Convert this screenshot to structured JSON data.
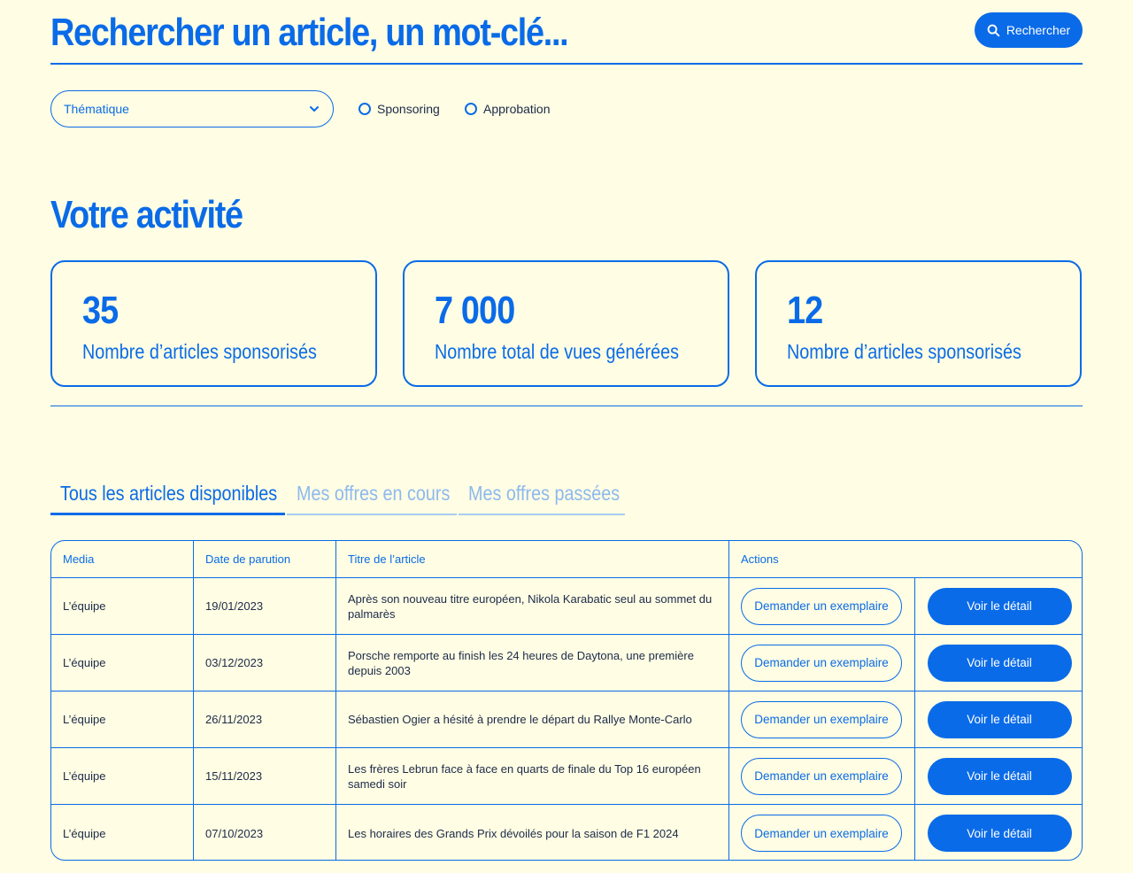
{
  "search": {
    "title": "Rechercher un article, un mot-clé...",
    "button_label": "Rechercher"
  },
  "filters": {
    "thematique_label": "Thématique",
    "radio_sponsoring": "Sponsoring",
    "radio_approbation": "Approbation"
  },
  "activity": {
    "title": "Votre activité",
    "cards": [
      {
        "value": "35",
        "label": "Nombre d’articles sponsorisés"
      },
      {
        "value": "7 000",
        "label": "Nombre total de vues générées"
      },
      {
        "value": "12",
        "label": "Nombre d’articles sponsorisés"
      }
    ]
  },
  "tabs": [
    {
      "label": "Tous les articles disponibles",
      "active": true
    },
    {
      "label": "Mes offres en cours",
      "active": false
    },
    {
      "label": "Mes offres passées",
      "active": false
    }
  ],
  "table": {
    "headers": {
      "media": "Media",
      "date": "Date de parution",
      "title": "Titre de l’article",
      "actions": "Actions"
    },
    "request_label": "Demander un exemplaire",
    "detail_label": "Voir le détail",
    "rows": [
      {
        "media": "L’équipe",
        "date": "19/01/2023",
        "title": "Après son nouveau titre européen, Nikola Karabatic seul au sommet du palmarès"
      },
      {
        "media": "L’équipe",
        "date": "03/12/2023",
        "title": "Porsche remporte au finish les 24 heures de Daytona, une première depuis 2003"
      },
      {
        "media": "L’équipe",
        "date": "26/11/2023",
        "title": "Sébastien Ogier a hésité à prendre le départ du Rallye Monte-Carlo"
      },
      {
        "media": "L’équipe",
        "date": "15/11/2023",
        "title": "Les frères Lebrun face à face en quarts de finale du Top 16 européen samedi soir"
      },
      {
        "media": "L’équipe",
        "date": "07/10/2023",
        "title": "Les horaires des Grands Prix dévoilés pour la saison de F1 2024"
      }
    ]
  },
  "colors": {
    "background": "#FFFDE3",
    "accent": "#0A6BE8",
    "inactive_tab": "#8DB9F0",
    "body_text": "#1C2A4A"
  }
}
